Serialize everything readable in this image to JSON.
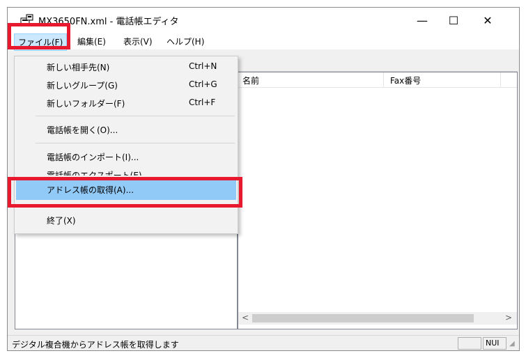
{
  "window": {
    "title": "MX3650FN.xml - 電話帳エディタ",
    "icon": "phonebook-app-icon",
    "controls": {
      "minimize": "—",
      "maximize": "☐",
      "close": "✕"
    }
  },
  "menubar": {
    "items": [
      {
        "label": "ファイル(F)",
        "state": "open"
      },
      {
        "label": "編集(E)"
      },
      {
        "label": "表示(V)"
      },
      {
        "label": "ヘルプ(H)"
      }
    ]
  },
  "file_menu": {
    "items": [
      {
        "label": "新しい相手先(N)",
        "shortcut": "Ctrl+N"
      },
      {
        "label": "新しいグループ(G)",
        "shortcut": "Ctrl+G"
      },
      {
        "label": "新しいフォルダー(F)",
        "shortcut": "Ctrl+F"
      },
      {
        "label": "電話帳を開く(O)..."
      },
      {
        "label": "電話帳のインポート(I)..."
      },
      {
        "label": "電話帳のエクスポート(E)..."
      },
      {
        "label": "アドレス帳の取得(A)...",
        "state": "highlighted"
      },
      {
        "label": "終了(X)"
      }
    ]
  },
  "list": {
    "columns": [
      "名前",
      "Fax番号"
    ],
    "rows": []
  },
  "statusbar": {
    "text": "デジタル複合機からアドレス帳を取得します",
    "num_indicator": "NUI"
  },
  "colors": {
    "highlight": "#91c9f7",
    "menu_open": "#cce8ff",
    "callout": "#e8182f"
  }
}
